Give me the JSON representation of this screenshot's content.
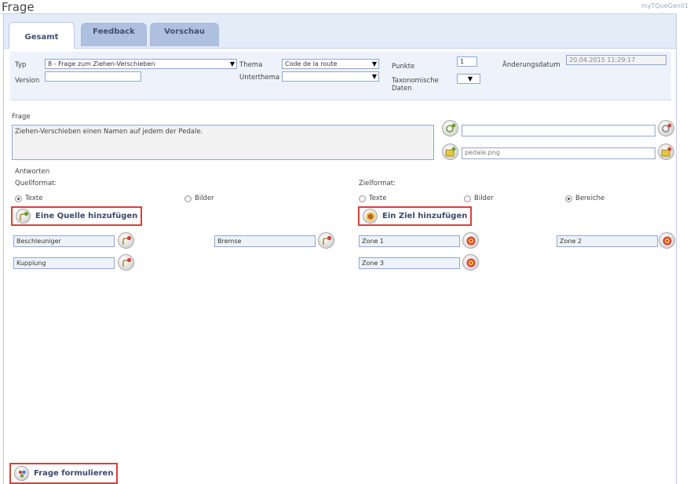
{
  "page": {
    "title": "Frage",
    "app_id": "myTQueGen01"
  },
  "tabs": [
    {
      "label": "Gesamt",
      "active": true
    },
    {
      "label": "Feedback",
      "active": false
    },
    {
      "label": "Vorschau",
      "active": false
    }
  ],
  "meta": {
    "typ_label": "Typ",
    "typ_value": "8 - Frage zum Ziehen-Verschieben",
    "version_label": "Version",
    "version_value": "",
    "thema_label": "Thema",
    "thema_value": "Code de la route",
    "unterthema_label": "Unterthema",
    "unterthema_value": "",
    "punkte_label": "Punkte",
    "punkte_value": "1",
    "taxonomie_label": "Taxonomische Daten",
    "taxonomie_value": "",
    "datum_label": "Änderungsdatum",
    "datum_value": "20.04.2015 11:29:17"
  },
  "question": {
    "label": "Frage",
    "text": "Ziehen-Verschieben einen Namen auf jedem der Pedale.",
    "audio_value": "",
    "image_value": "pedale.png"
  },
  "answers": {
    "label": "Antworten",
    "source_format_label": "Quellformat:",
    "source_options": [
      {
        "label": "Texte",
        "selected": true
      },
      {
        "label": "Bilder",
        "selected": false
      }
    ],
    "add_source_label": "Eine Quelle hinzufügen",
    "sources": [
      "Beschleuniger",
      "Bremse",
      "Kupplung"
    ],
    "target_format_label": "Zielformat:",
    "target_options": [
      {
        "label": "Texte",
        "selected": false
      },
      {
        "label": "Bilder",
        "selected": false
      },
      {
        "label": "Bereiche",
        "selected": true
      }
    ],
    "add_target_label": "Ein Ziel hinzufügen",
    "targets": [
      "Zone 1",
      "Zone 2",
      "Zone 3"
    ]
  },
  "footer": {
    "formulate_label": "Frage formulieren"
  }
}
